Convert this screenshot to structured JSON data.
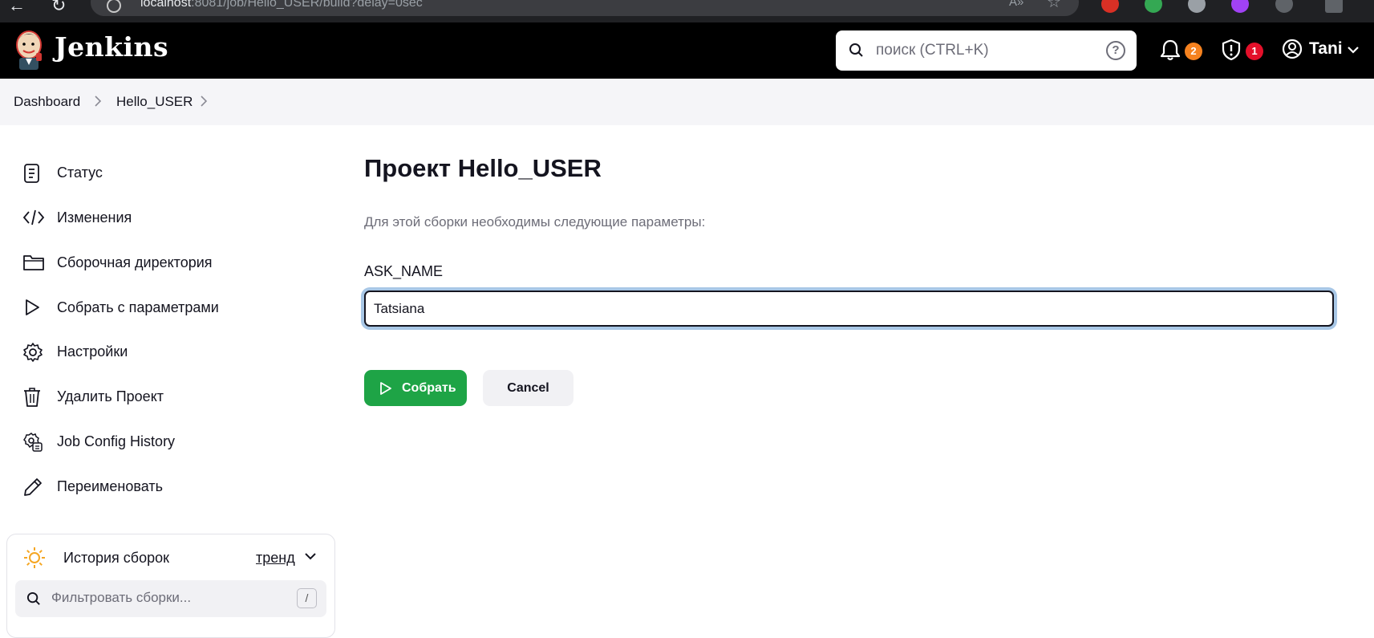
{
  "browser": {
    "url_host": "localhost",
    "url_rest": ":8081/job/Hello_USER/build?delay=0sec"
  },
  "header": {
    "brand": "Jenkins",
    "search_placeholder": "поиск (CTRL+K)",
    "notifications_count": "2",
    "security_count": "1",
    "user_name": "Tani",
    "colors": {
      "notification_badge": "#f5821f",
      "security_badge": "#e3102a"
    }
  },
  "breadcrumb": {
    "items": [
      "Dashboard",
      "Hello_USER"
    ]
  },
  "sidebar": {
    "items": [
      {
        "label": "Статус",
        "icon": "status-icon"
      },
      {
        "label": "Изменения",
        "icon": "code-icon"
      },
      {
        "label": "Сборочная директория",
        "icon": "folder-icon"
      },
      {
        "label": "Собрать с параметрами",
        "icon": "play-icon"
      },
      {
        "label": "Настройки",
        "icon": "gear-icon"
      },
      {
        "label": "Удалить Проект",
        "icon": "trash-icon"
      },
      {
        "label": "Job Config History",
        "icon": "config-history-icon"
      },
      {
        "label": "Переименовать",
        "icon": "pencil-icon"
      }
    ],
    "build_history": {
      "title": "История сборок",
      "trend_label": "тренд",
      "filter_placeholder": "Фильтровать сборки...",
      "filter_shortcut": "/"
    }
  },
  "main": {
    "title": "Проект Hello_USER",
    "description": "Для этой сборки необходимы следующие параметры:",
    "parameter": {
      "name": "ASK_NAME",
      "value": "Tatsiana"
    },
    "build_button": "Собрать",
    "cancel_button": "Cancel",
    "colors": {
      "build_button": "#1ea446"
    }
  }
}
